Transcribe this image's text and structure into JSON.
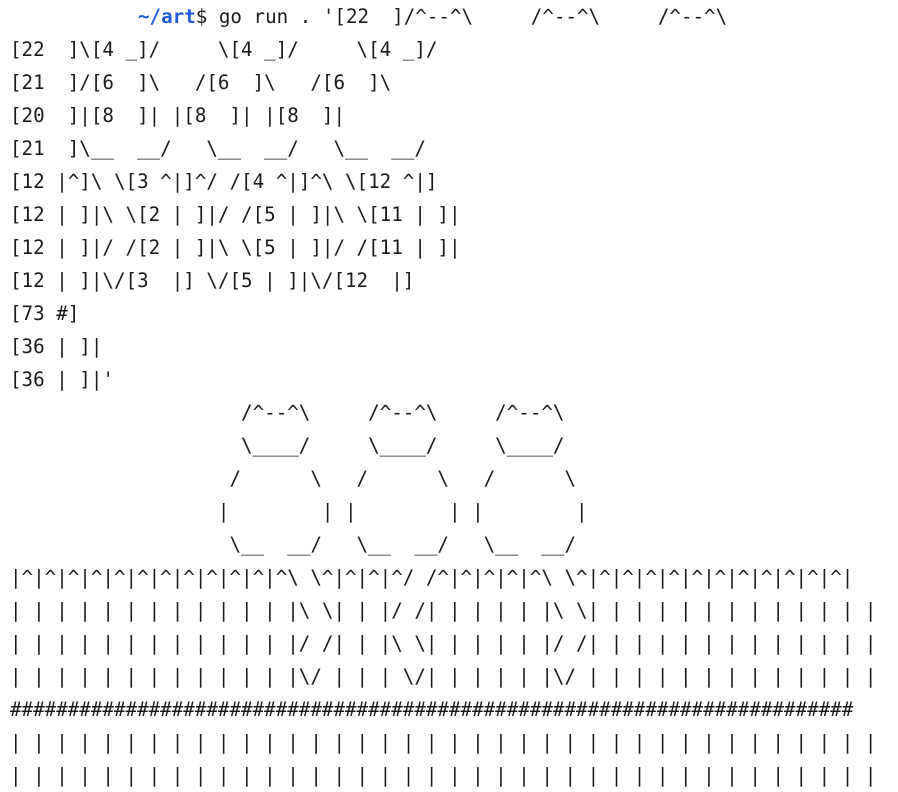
{
  "prompt": {
    "dir": "~/art",
    "symbol": "$",
    "command": " go run . '[22  ]/^--^\\     /^--^\\     /^--^\\"
  },
  "command_lines": [
    "[22  ]\\[4 _]/     \\[4 _]/     \\[4 _]/",
    "[21  ]/[6  ]\\   /[6  ]\\   /[6  ]\\",
    "[20  ]|[8  ]| |[8  ]| |[8  ]|",
    "[21  ]\\__  __/   \\__  __/   \\__  __/",
    "[12 |^]\\ \\[3 ^|]^/ /[4 ^|]^\\ \\[12 ^|]",
    "[12 | ]|\\ \\[2 | ]|/ /[5 | ]|\\ \\[11 | ]|",
    "[12 | ]|/ /[2 | ]|\\ \\[5 | ]|/ /[11 | ]|",
    "[12 | ]|\\/[3  |] \\/[5 | ]|\\/[12  |]",
    "[73 #]",
    "[36 | ]|",
    "[36 | ]|'"
  ],
  "output_lines": [
    "                    /^--^\\     /^--^\\     /^--^\\",
    "                    \\____/     \\____/     \\____/",
    "                   /      \\   /      \\   /      \\",
    "                  |        | |        | |        |",
    "                   \\__  __/   \\__  __/   \\__  __/",
    "|^|^|^|^|^|^|^|^|^|^|^|^\\ \\^|^|^|^/ /^|^|^|^|^\\ \\^|^|^|^|^|^|^|^|^|^|^|^|",
    "| | | | | | | | | | | | |\\ \\| | |/ /| | | | | |\\ \\| | | | | | | | | | | | |",
    "| | | | | | | | | | | | |/ /| | |\\ \\| | | | | |/ /| | | | | | | | | | | | |",
    "| | | | | | | | | | | | |\\/ | | | \\/| | | | | |\\/ | | | | | | | | | | | | |",
    "#########################################################################",
    "| | | | | | | | | | | | | | | | | | | | | | | | | | | | | | | | | | | | | |",
    "| | | | | | | | | | | | | | | | | | | | | | | | | | | | | | | | | | | | | |"
  ]
}
